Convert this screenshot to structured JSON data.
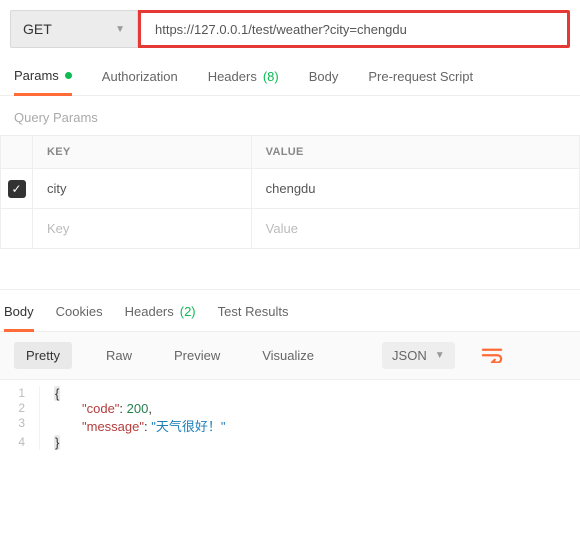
{
  "request": {
    "method": "GET",
    "url": "https://127.0.0.1/test/weather?city=chengdu"
  },
  "tabs": {
    "params": "Params",
    "authorization": "Authorization",
    "headers": "Headers",
    "headers_count": "(8)",
    "body": "Body",
    "prerequest": "Pre-request Script"
  },
  "section": {
    "query_params": "Query Params",
    "key_header": "KEY",
    "value_header": "VALUE"
  },
  "params": {
    "row1": {
      "key": "city",
      "value": "chengdu"
    },
    "placeholder": {
      "key": "Key",
      "value": "Value"
    }
  },
  "response_tabs": {
    "body": "Body",
    "cookies": "Cookies",
    "headers": "Headers",
    "headers_count": "(2)",
    "tests": "Test Results"
  },
  "viewbar": {
    "pretty": "Pretty",
    "raw": "Raw",
    "preview": "Preview",
    "visualize": "Visualize",
    "format": "JSON"
  },
  "json_body": {
    "line1": "{",
    "code_key": "\"code\"",
    "code_val": "200",
    "msg_key": "\"message\"",
    "msg_val": "\"天气很好！\"",
    "line4": "}"
  }
}
